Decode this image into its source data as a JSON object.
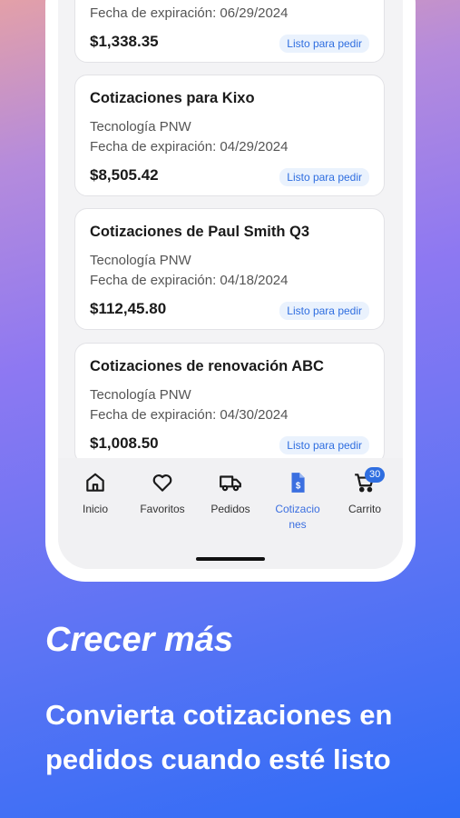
{
  "quotes": [
    {
      "title": "",
      "company": "",
      "expiry": "Fecha de expiración: 06/29/2024",
      "amount": "$1,338.35",
      "status": "Listo para pedir"
    },
    {
      "title": "Cotizaciones para Kixo",
      "company": "Tecnología PNW",
      "expiry": "Fecha de expiración: 04/29/2024",
      "amount": "$8,505.42",
      "status": "Listo para pedir"
    },
    {
      "title": "Cotizaciones de Paul Smith Q3",
      "company": "Tecnología PNW",
      "expiry": "Fecha de expiración: 04/18/2024",
      "amount": "$112,45.80",
      "status": "Listo para pedir"
    },
    {
      "title": "Cotizaciones de renovación ABC",
      "company": "Tecnología PNW",
      "expiry": "Fecha de expiración: 04/30/2024",
      "amount": "$1,008.50",
      "status": "Listo para pedir"
    }
  ],
  "tabs": [
    {
      "label": "Inicio",
      "icon": "home-icon"
    },
    {
      "label": "Favoritos",
      "icon": "heart-icon"
    },
    {
      "label": "Pedidos",
      "icon": "truck-icon"
    },
    {
      "label": "Cotizacio\nnes",
      "icon": "quote-document-icon"
    },
    {
      "label": "Carrito",
      "icon": "cart-icon"
    }
  ],
  "cart_count": "30",
  "colors": {
    "accent": "#2f6ee0",
    "badge_bg": "#eaf2fd"
  },
  "promo": {
    "headline": "Crecer más",
    "subline": "Convierta cotizaciones en pedidos cuando esté listo"
  }
}
